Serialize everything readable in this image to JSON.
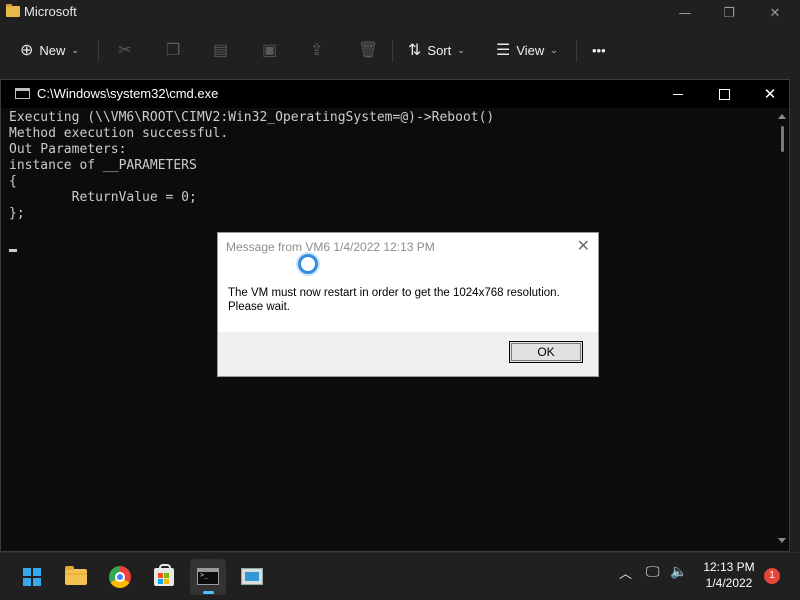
{
  "explorer": {
    "title": "Microsoft",
    "toolbar": {
      "new_label": "New",
      "sort_label": "Sort",
      "view_label": "View",
      "more_label": "•••"
    }
  },
  "cmd": {
    "title": "C:\\Windows\\system32\\cmd.exe",
    "lines": [
      "Executing (\\\\VM6\\ROOT\\CIMV2:Win32_OperatingSystem=@)->Reboot()",
      "Method execution successful.",
      "Out Parameters:",
      "instance of __PARAMETERS",
      "{",
      "        ReturnValue = 0;",
      "};"
    ]
  },
  "dialog": {
    "title": "Message from VM6 1/4/2022 12:13 PM",
    "message_line1": "The VM must now restart in order to get the 1024x768 resolution.",
    "message_line2": "Please wait.",
    "ok_label": "OK"
  },
  "taskbar": {
    "apps": [
      "start-icon",
      "file-explorer-icon",
      "chrome-icon",
      "store-icon",
      "cmd-icon",
      "remote-desktop-icon"
    ],
    "time": "12:13 PM",
    "date": "1/4/2022",
    "notification_count": "1"
  },
  "colors": {
    "console_bg": "#0c0c0c",
    "console_text": "#cccccc",
    "taskbar_bg": "#202020",
    "accent": "#4cc2ff",
    "badge": "#e8453c"
  }
}
